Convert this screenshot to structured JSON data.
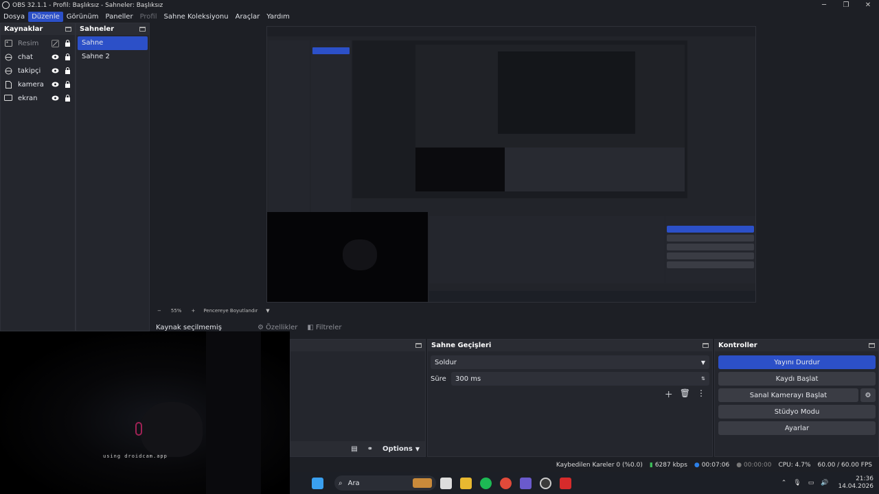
{
  "window": {
    "title": "OBS 32.1.1 - Profil: Başlıksız - Sahneler: Başlıksız"
  },
  "menu": [
    "Dosya",
    "Düzenle",
    "Görünüm",
    "Paneller",
    "Profil",
    "Sahne Koleksiyonu",
    "Araçlar",
    "Yardım"
  ],
  "sources": {
    "title": "Kaynaklar",
    "items": [
      {
        "label": "Resim",
        "icon": "image-icon"
      },
      {
        "label": "chat",
        "icon": "globe-icon"
      },
      {
        "label": "takipçi",
        "icon": "globe-icon"
      },
      {
        "label": "kamera",
        "icon": "file-icon"
      },
      {
        "label": "ekran",
        "icon": "monitor-icon"
      }
    ]
  },
  "scenes": {
    "title": "Sahneler",
    "items": [
      "Sahne",
      "Sahne 2"
    ]
  },
  "zoom": {
    "minus": "−",
    "value": "55%",
    "plus": "+",
    "mode": "Pencereye Boyutlandır"
  },
  "context": {
    "no_source": "Kaynak seçilmemiş",
    "properties": "Özellikler",
    "filters": "Filtreler"
  },
  "mixer_toolbar": {
    "options": "Options"
  },
  "transitions": {
    "title": "Sahne Geçişleri",
    "type": "Soldur",
    "duration_label": "Süre",
    "duration": "300 ms"
  },
  "controls": {
    "title": "Kontroller",
    "stop_stream": "Yayını Durdur",
    "start_record": "Kaydı Başlat",
    "virtual_cam": "Sanal Kamerayı Başlat",
    "studio_mode": "Stüdyo Modu",
    "settings": "Ayarlar"
  },
  "status": {
    "dropped": "Kaybedilen Kareler 0 (%0.0)",
    "bitrate": "6287 kbps",
    "stream_time": "00:07:06",
    "record_time": "00:00:00",
    "cpu": "CPU: 4.7%",
    "fps": "60.00 / 60.00 FPS"
  },
  "webcam": {
    "caption": "using droidcam.app"
  },
  "taskbar": {
    "search": "Ara",
    "time": "21:36",
    "date": "14.04.2026"
  },
  "colors": {
    "accent": "#2c50c8",
    "panel": "#24262d",
    "bg": "#1d1f25"
  }
}
